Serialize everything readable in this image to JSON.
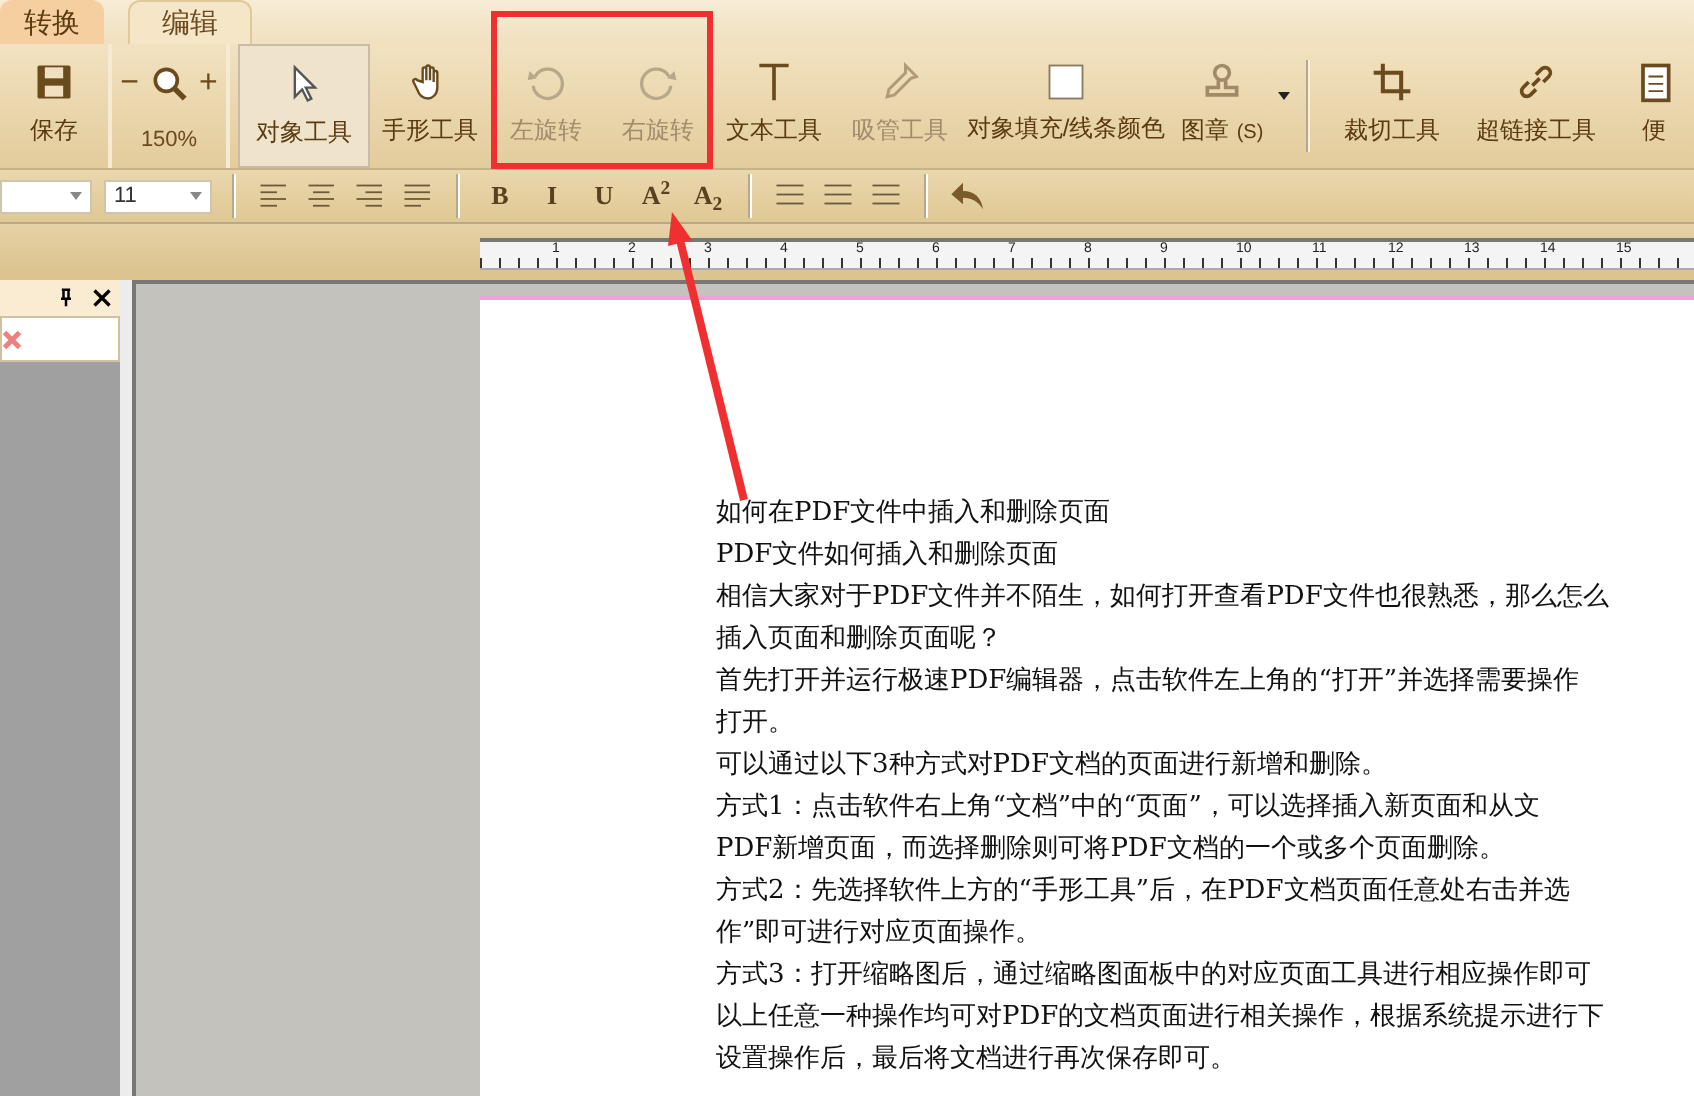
{
  "tabs": [
    {
      "label": "转换",
      "selected": true
    },
    {
      "label": "编辑",
      "selected": false
    }
  ],
  "toolbar": [
    {
      "kind": "save",
      "label": "保存",
      "selected": false,
      "disabled": false
    },
    {
      "kind": "zoom",
      "label": "150%",
      "minus": "−",
      "plus": "+"
    },
    {
      "kind": "pointer",
      "label": "对象工具",
      "selected": true,
      "disabled": false
    },
    {
      "kind": "hand",
      "label": "手形工具",
      "selected": false,
      "disabled": false
    },
    {
      "kind": "rotate-left",
      "label": "左旋转",
      "selected": false,
      "disabled": true
    },
    {
      "kind": "rotate-right",
      "label": "右旋转",
      "selected": false,
      "disabled": true
    },
    {
      "kind": "text",
      "label": "文本工具",
      "selected": false,
      "disabled": false
    },
    {
      "kind": "eyedropper",
      "label": "吸管工具",
      "selected": false,
      "disabled": true
    },
    {
      "kind": "fill",
      "label": "对象填充/线条颜色",
      "selected": false,
      "disabled": false
    },
    {
      "kind": "stamp",
      "label": "图章",
      "shortcut": "(S)",
      "selected": false,
      "disabled": false
    },
    {
      "kind": "separator"
    },
    {
      "kind": "crop",
      "label": "裁切工具",
      "selected": false,
      "disabled": false
    },
    {
      "kind": "link",
      "label": "超链接工具",
      "selected": false,
      "disabled": false
    },
    {
      "kind": "note",
      "label": "便",
      "selected": false,
      "disabled": false
    }
  ],
  "format_bar": {
    "font_size": "11",
    "buttons": [
      {
        "kind": "align-left"
      },
      {
        "kind": "align-center"
      },
      {
        "kind": "align-right"
      },
      {
        "kind": "align-justify"
      },
      {
        "kind": "separator"
      },
      {
        "kind": "text",
        "label": "B"
      },
      {
        "kind": "text",
        "label": "I"
      },
      {
        "kind": "text",
        "label": "U"
      },
      {
        "kind": "text",
        "label": "A$^{2}$"
      },
      {
        "kind": "text",
        "label": "A$_{2}$"
      },
      {
        "kind": "separator"
      },
      {
        "kind": "list"
      },
      {
        "kind": "list"
      },
      {
        "kind": "list"
      },
      {
        "kind": "separator"
      },
      {
        "kind": "undo"
      }
    ]
  },
  "ruler": [
    "1",
    "2",
    "3",
    "4",
    "5",
    "6",
    "7",
    "8",
    "9",
    "10",
    "11",
    "12",
    "13",
    "14",
    "15"
  ],
  "document_lines": [
    "如何在PDF文件中插入和删除页面",
    "PDF文件如何插入和删除页面",
    "相信大家对于PDF文件并不陌生，如何打开查看PDF文件也很熟悉，那么怎么",
    "插入页面和删除页面呢？",
    "首先打开并运行极速PDF编辑器，点击软件左上角的“打开”并选择需要操作",
    "打开。",
    "可以通过以下3种方式对PDF文档的页面进行新增和删除。",
    "方式1：点击软件右上角“文档”中的“页面”，可以选择插入新页面和从文",
    "PDF新增页面，而选择删除则可将PDF文档的一个或多个页面删除。",
    "方式2：先选择软件上方的“手形工具”后，在PDF文档页面任意处右击并选",
    "作”即可进行对应页面操作。",
    "方式3：打开缩略图后，通过缩略图面板中的对应页面工具进行相应操作即可",
    "以上任意一种操作均可对PDF的文档页面进行相关操作，根据系统提示进行下",
    "设置操作后，最后将文档进行再次保存即可。"
  ]
}
